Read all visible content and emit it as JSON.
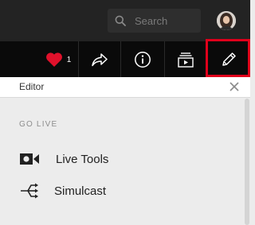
{
  "search": {
    "placeholder": "Search"
  },
  "actions": {
    "like_count": "1"
  },
  "panel": {
    "title": "Editor",
    "section_label": "GO LIVE",
    "items": [
      {
        "label": "Live Tools",
        "icon": "camera-icon"
      },
      {
        "label": "Simulcast",
        "icon": "simulcast-icon"
      }
    ]
  },
  "colors": {
    "topbar": "#232323",
    "actionbar": "#0a0a0a",
    "highlight": "#e0001b",
    "heart": "#e0112b",
    "panel_bg": "#ececec"
  }
}
